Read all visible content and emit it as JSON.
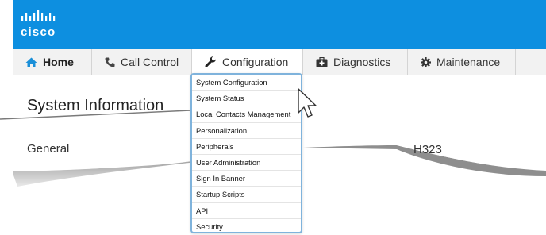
{
  "brand": {
    "logo_text": "cisco",
    "color": "#0d8fe0"
  },
  "nav": {
    "items": [
      {
        "label": "Home",
        "icon": "home-icon"
      },
      {
        "label": "Call Control",
        "icon": "phone-icon"
      },
      {
        "label": "Configuration",
        "icon": "wrench-icon"
      },
      {
        "label": "Diagnostics",
        "icon": "medkit-icon"
      },
      {
        "label": "Maintenance",
        "icon": "gear-icon"
      }
    ],
    "active": "Configuration"
  },
  "page": {
    "title": "System Information",
    "section_label": "General",
    "column_label": "H323"
  },
  "dropdown": {
    "items": [
      "System Configuration",
      "System Status",
      "Local Contacts Management",
      "Personalization",
      "Peripherals",
      "User Administration",
      "Sign In Banner",
      "Startup Scripts",
      "API",
      "Security"
    ]
  }
}
